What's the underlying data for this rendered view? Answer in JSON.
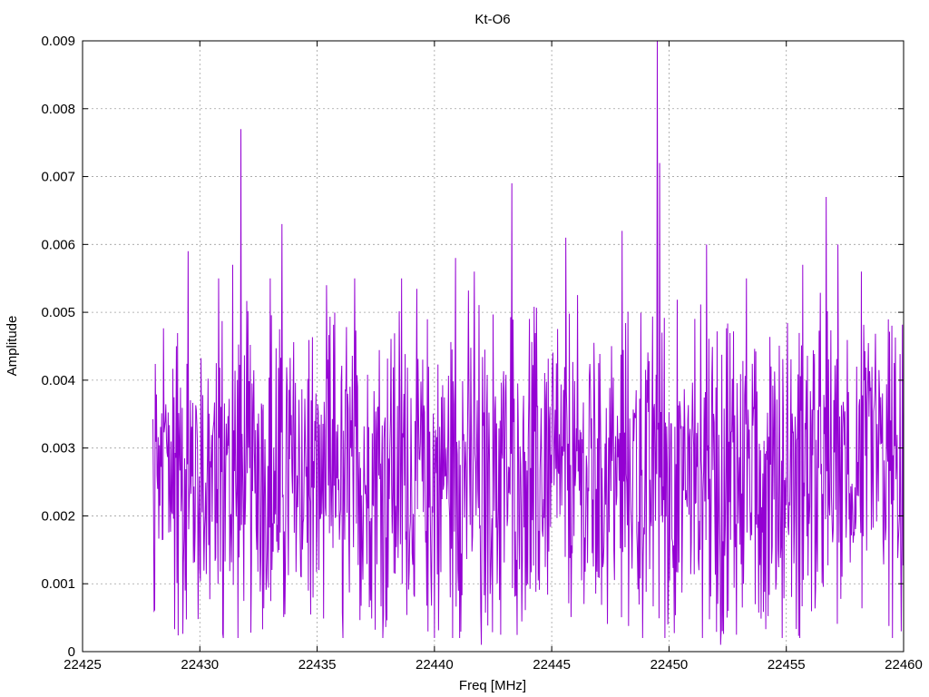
{
  "chart_data": {
    "type": "line",
    "title": "Kt-O6",
    "xlabel": "Freq [MHz]",
    "ylabel": "Amplitude",
    "xlim": [
      22425,
      22460
    ],
    "ylim": [
      0,
      0.009
    ],
    "xticks": [
      22425,
      22430,
      22435,
      22440,
      22445,
      22450,
      22455,
      22460
    ],
    "yticks": [
      0,
      0.001,
      0.002,
      0.003,
      0.004,
      0.005,
      0.006,
      0.007,
      0.008,
      0.009
    ],
    "xtick_labels": [
      "22425",
      "22430",
      "22435",
      "22440",
      "22445",
      "22450",
      "22455",
      "22460"
    ],
    "ytick_labels": [
      "0",
      "0.001",
      "0.002",
      "0.003",
      "0.004",
      "0.005",
      "0.006",
      "0.007",
      "0.008",
      "0.009"
    ],
    "grid": true,
    "legend": "none",
    "series": [
      {
        "color": "#9400d3",
        "x_start": 22428.0,
        "x_end": 22460.0,
        "x_step": 0.025,
        "baseline": 0.0025,
        "noise_amplitude": 0.0018,
        "peaks": [
          {
            "x": 22429.0,
            "y": 0.0045
          },
          {
            "x": 22429.5,
            "y": 0.0059
          },
          {
            "x": 22430.8,
            "y": 0.0055
          },
          {
            "x": 22431.4,
            "y": 0.0057
          },
          {
            "x": 22431.75,
            "y": 0.0077
          },
          {
            "x": 22433.0,
            "y": 0.0055
          },
          {
            "x": 22433.5,
            "y": 0.0063
          },
          {
            "x": 22436.6,
            "y": 0.0055
          },
          {
            "x": 22438.6,
            "y": 0.0055
          },
          {
            "x": 22440.9,
            "y": 0.0058
          },
          {
            "x": 22441.7,
            "y": 0.0056
          },
          {
            "x": 22443.3,
            "y": 0.0069
          },
          {
            "x": 22445.6,
            "y": 0.0061
          },
          {
            "x": 22448.0,
            "y": 0.0062
          },
          {
            "x": 22449.5,
            "y": 0.009
          },
          {
            "x": 22449.6,
            "y": 0.0072
          },
          {
            "x": 22451.6,
            "y": 0.006
          },
          {
            "x": 22453.3,
            "y": 0.0055
          },
          {
            "x": 22455.7,
            "y": 0.0057
          },
          {
            "x": 22456.7,
            "y": 0.0067
          },
          {
            "x": 22457.2,
            "y": 0.006
          },
          {
            "x": 22458.2,
            "y": 0.0056
          }
        ],
        "dips": [
          {
            "x": 22428.05,
            "y": 0.0006
          },
          {
            "x": 22431.0,
            "y": 0.0002
          },
          {
            "x": 22436.1,
            "y": 0.0002
          },
          {
            "x": 22437.8,
            "y": 0.0002
          },
          {
            "x": 22440.0,
            "y": 0.0002
          },
          {
            "x": 22442.0,
            "y": 0.0001
          },
          {
            "x": 22449.95,
            "y": 0.0004
          },
          {
            "x": 22452.2,
            "y": 0.0001
          },
          {
            "x": 22459.9,
            "y": 0.0003
          }
        ]
      }
    ]
  }
}
